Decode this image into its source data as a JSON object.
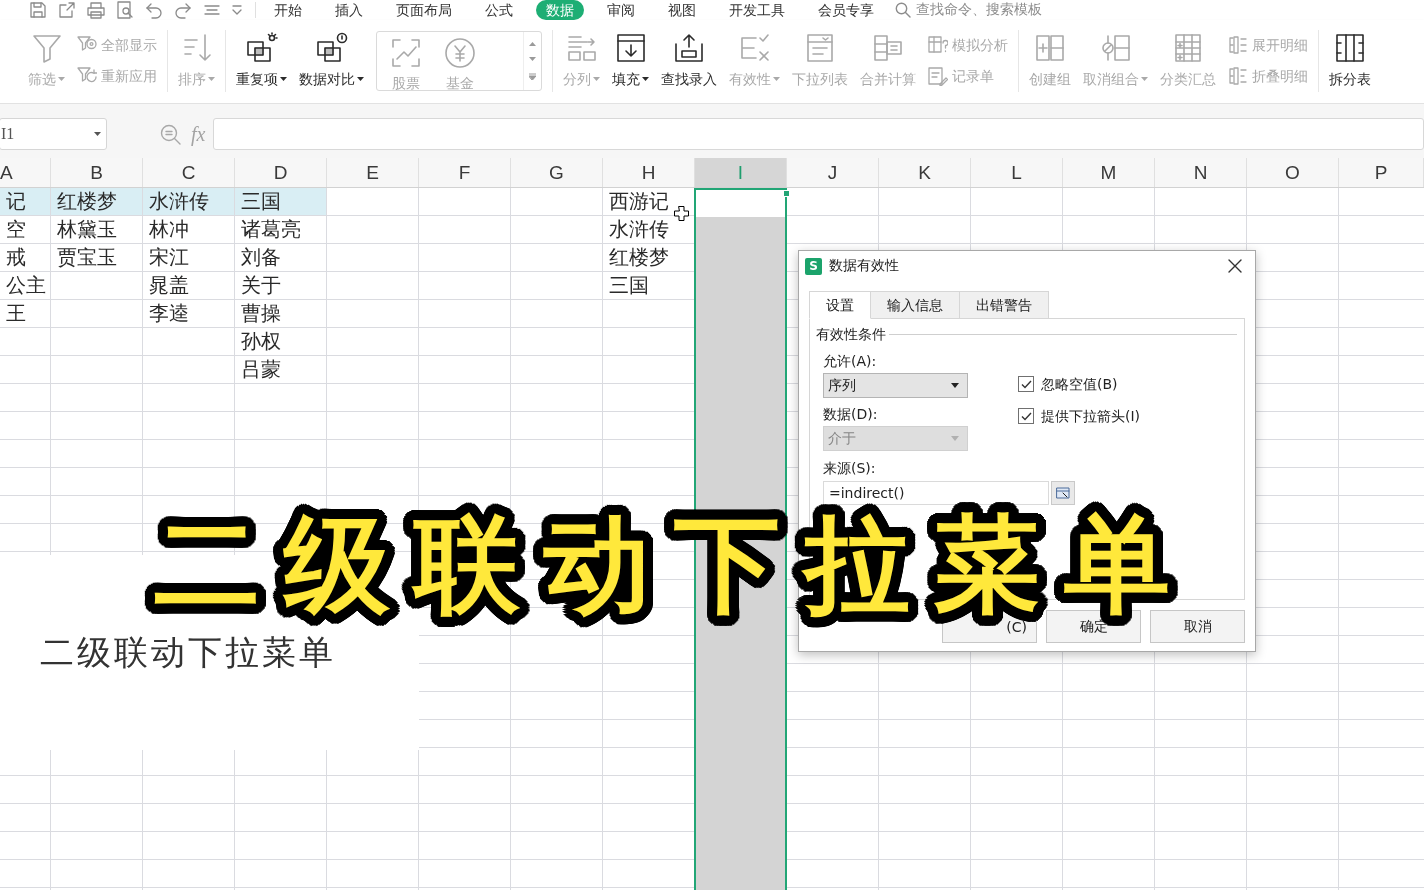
{
  "title_bar": {
    "tabs": [
      {
        "label": "开始",
        "selected": false
      },
      {
        "label": "插入",
        "selected": false
      },
      {
        "label": "页面布局",
        "selected": false
      },
      {
        "label": "公式",
        "selected": false
      },
      {
        "label": "数据",
        "selected": true
      },
      {
        "label": "审阅",
        "selected": false
      },
      {
        "label": "视图",
        "selected": false
      },
      {
        "label": "开发工具",
        "selected": false
      },
      {
        "label": "会员专享",
        "selected": false
      }
    ],
    "search": {
      "placeholder": "查找命令、搜索模板"
    }
  },
  "ribbon": {
    "groups": [
      {
        "items": [
          {
            "kind": "large",
            "label": "筛选",
            "dropdown": true,
            "disabled": true
          },
          {
            "kind": "stack",
            "entries": [
              {
                "label": "全部显示",
                "disabled": true
              },
              {
                "label": "重新应用",
                "disabled": true
              }
            ]
          }
        ]
      },
      {
        "items": [
          {
            "kind": "large",
            "label": "排序",
            "dropdown": true,
            "disabled": true
          }
        ]
      },
      {
        "items": [
          {
            "kind": "large",
            "label": "重复项",
            "dropdown": true,
            "disabled": false
          },
          {
            "kind": "large",
            "label": "数据对比",
            "dropdown": true,
            "disabled": false
          },
          {
            "kind": "gallery",
            "disabled": true,
            "entries": [
              {
                "label": "股票"
              },
              {
                "label": "基金"
              }
            ]
          }
        ]
      },
      {
        "items": [
          {
            "kind": "large",
            "label": "分列",
            "dropdown": true,
            "disabled": true
          },
          {
            "kind": "large",
            "label": "填充",
            "dropdown": true,
            "disabled": false
          },
          {
            "kind": "large",
            "label": "查找录入",
            "dropdown": false,
            "disabled": false
          },
          {
            "kind": "large",
            "label": "有效性",
            "dropdown": true,
            "disabled": true
          },
          {
            "kind": "large",
            "label": "下拉列表",
            "dropdown": false,
            "disabled": true
          },
          {
            "kind": "large",
            "label": "合并计算",
            "dropdown": false,
            "disabled": true
          },
          {
            "kind": "stack",
            "entries": [
              {
                "label": "模拟分析",
                "disabled": true
              },
              {
                "label": "记录单",
                "disabled": true
              }
            ]
          }
        ]
      },
      {
        "items": [
          {
            "kind": "large",
            "label": "创建组",
            "dropdown": false,
            "disabled": true
          },
          {
            "kind": "large",
            "label": "取消组合",
            "dropdown": true,
            "disabled": true
          },
          {
            "kind": "large",
            "label": "分类汇总",
            "dropdown": false,
            "disabled": true
          },
          {
            "kind": "stack",
            "entries": [
              {
                "label": "展开明细",
                "disabled": true
              },
              {
                "label": "折叠明细",
                "disabled": true
              }
            ]
          }
        ]
      },
      {
        "items": [
          {
            "kind": "large",
            "label": "拆分表",
            "dropdown": false,
            "disabled": false
          }
        ]
      }
    ]
  },
  "formula_bar": {
    "name_box": "I1",
    "function_label": "fx"
  },
  "sheet": {
    "columns": [
      {
        "label": "A",
        "selected": false
      },
      {
        "label": "B",
        "selected": false
      },
      {
        "label": "C",
        "selected": false
      },
      {
        "label": "D",
        "selected": false
      },
      {
        "label": "E",
        "selected": false
      },
      {
        "label": "F",
        "selected": false
      },
      {
        "label": "G",
        "selected": false
      },
      {
        "label": "H",
        "selected": false
      },
      {
        "label": "I",
        "selected": true
      },
      {
        "label": "J",
        "selected": false
      },
      {
        "label": "K",
        "selected": false
      },
      {
        "label": "L",
        "selected": false
      },
      {
        "label": "M",
        "selected": false
      },
      {
        "label": "N",
        "selected": false
      },
      {
        "label": "O",
        "selected": false
      },
      {
        "label": "P",
        "selected": false
      }
    ],
    "rows": [
      {
        "cells": [
          {
            "text": "记",
            "highlighted": true
          },
          {
            "text": "红楼梦",
            "highlighted": true
          },
          {
            "text": "水浒传",
            "highlighted": true
          },
          {
            "text": "三国",
            "highlighted": true
          },
          null,
          null,
          null,
          {
            "text": "西游记",
            "highlighted": false
          }
        ]
      },
      {
        "cells": [
          {
            "text": "空",
            "highlighted": false
          },
          {
            "text": "林黛玉",
            "highlighted": false
          },
          {
            "text": "林冲",
            "highlighted": false
          },
          {
            "text": "诸葛亮",
            "highlighted": false
          },
          null,
          null,
          null,
          {
            "text": "水浒传",
            "highlighted": false
          }
        ]
      },
      {
        "cells": [
          {
            "text": "戒",
            "highlighted": false
          },
          {
            "text": "贾宝玉",
            "highlighted": false
          },
          {
            "text": "宋江",
            "highlighted": false
          },
          {
            "text": "刘备",
            "highlighted": false
          },
          null,
          null,
          null,
          {
            "text": "红楼梦",
            "highlighted": false
          }
        ]
      },
      {
        "cells": [
          {
            "text": "公主",
            "highlighted": false
          },
          null,
          {
            "text": "晁盖",
            "highlighted": false
          },
          {
            "text": "关于",
            "highlighted": false
          },
          null,
          null,
          null,
          {
            "text": "三国",
            "highlighted": false
          }
        ]
      },
      {
        "cells": [
          {
            "text": "王",
            "highlighted": false
          },
          null,
          {
            "text": "李逵",
            "highlighted": false
          },
          {
            "text": "曹操",
            "highlighted": false
          }
        ]
      },
      {
        "cells": [
          null,
          null,
          null,
          {
            "text": "孙权",
            "highlighted": false
          }
        ]
      },
      {
        "cells": [
          null,
          null,
          null,
          {
            "text": "吕蒙",
            "highlighted": false
          }
        ]
      }
    ],
    "text_box": {
      "text": "二级联动下拉菜单"
    }
  },
  "dialog": {
    "logo": "S",
    "title": "数据有效性",
    "tabs": [
      {
        "label": "设置",
        "selected": true
      },
      {
        "label": "输入信息",
        "selected": false
      },
      {
        "label": "出错警告",
        "selected": false
      }
    ],
    "group_title": "有效性条件",
    "fields": [
      {
        "label": "允许(A):",
        "value": "序列",
        "disabled": false
      },
      {
        "label": "数据(D):",
        "value": "介于",
        "disabled": true
      }
    ],
    "checkboxes": [
      {
        "label": "忽略空值(B)",
        "checked": true
      },
      {
        "label": "提供下拉箭头(I)",
        "checked": true
      }
    ],
    "source": {
      "label": "来源(S):",
      "value": "=indirect()"
    },
    "buttons": [
      {
        "label": "(C)"
      },
      {
        "label": "确定"
      },
      {
        "label": "取消"
      }
    ]
  },
  "caption": {
    "text": "二级联动下拉菜单"
  }
}
